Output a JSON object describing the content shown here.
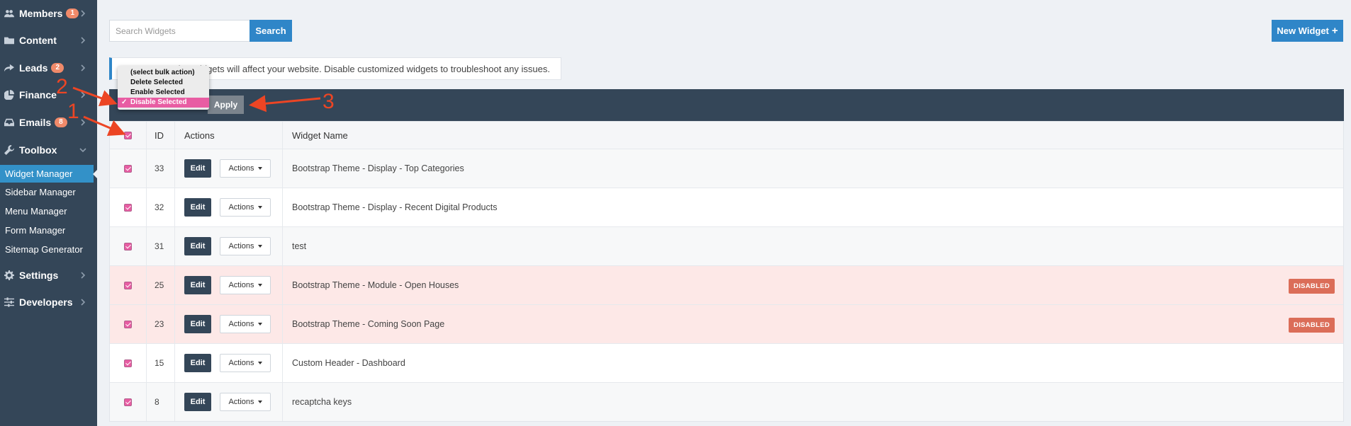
{
  "sidebar": {
    "items": [
      {
        "label": "Members",
        "icon": "users-icon",
        "badge": "1"
      },
      {
        "label": "Content",
        "icon": "folder-icon"
      },
      {
        "label": "Leads",
        "icon": "share-icon",
        "badge": "2"
      },
      {
        "label": "Finance",
        "icon": "pie-chart-icon"
      },
      {
        "label": "Emails",
        "icon": "inbox-icon",
        "badge": "8"
      },
      {
        "label": "Toolbox",
        "icon": "wrench-icon"
      }
    ],
    "sub_items": [
      {
        "label": "Widget Manager",
        "active": true
      },
      {
        "label": "Sidebar Manager"
      },
      {
        "label": "Menu Manager"
      },
      {
        "label": "Form Manager"
      },
      {
        "label": "Sitemap Generator"
      }
    ],
    "bottom_items": [
      {
        "label": "Settings",
        "icon": "gear-icon"
      },
      {
        "label": "Developers",
        "icon": "sliders-icon"
      }
    ]
  },
  "search": {
    "placeholder": "Search Widgets",
    "button_label": "Search"
  },
  "new_widget_label": "New Widget",
  "alert_text": "ting widgets will affect your website. Disable customized widgets to troubleshoot any issues.",
  "bulk": {
    "options": [
      "(select bulk action)",
      "Delete Selected",
      "Enable Selected",
      "Disable Selected"
    ],
    "selected": "Disable Selected",
    "apply_label": "Apply"
  },
  "table": {
    "headers": {
      "id": "ID",
      "actions": "Actions",
      "name": "Widget Name"
    },
    "edit_label": "Edit",
    "actions_label": "Actions",
    "disabled_label": "DISABLED",
    "rows": [
      {
        "id": "33",
        "name": "Bootstrap Theme - Display - Top Categories",
        "disabled": false
      },
      {
        "id": "32",
        "name": "Bootstrap Theme - Display - Recent Digital Products",
        "disabled": false
      },
      {
        "id": "31",
        "name": "test",
        "disabled": false
      },
      {
        "id": "25",
        "name": "Bootstrap Theme - Module - Open Houses",
        "disabled": true
      },
      {
        "id": "23",
        "name": "Bootstrap Theme - Coming Soon Page",
        "disabled": true
      },
      {
        "id": "15",
        "name": "Custom Header - Dashboard",
        "disabled": false
      },
      {
        "id": "8",
        "name": "recaptcha keys",
        "disabled": false
      }
    ]
  },
  "annotations": [
    "1",
    "2",
    "3"
  ],
  "colors": {
    "sidebar_bg": "#344658",
    "accent_blue": "#2f86c8",
    "checkbox_pink": "#e85da3",
    "disabled_badge": "#db6d58",
    "disabled_row": "#fde8e7",
    "annotation_red": "#ec4524"
  }
}
